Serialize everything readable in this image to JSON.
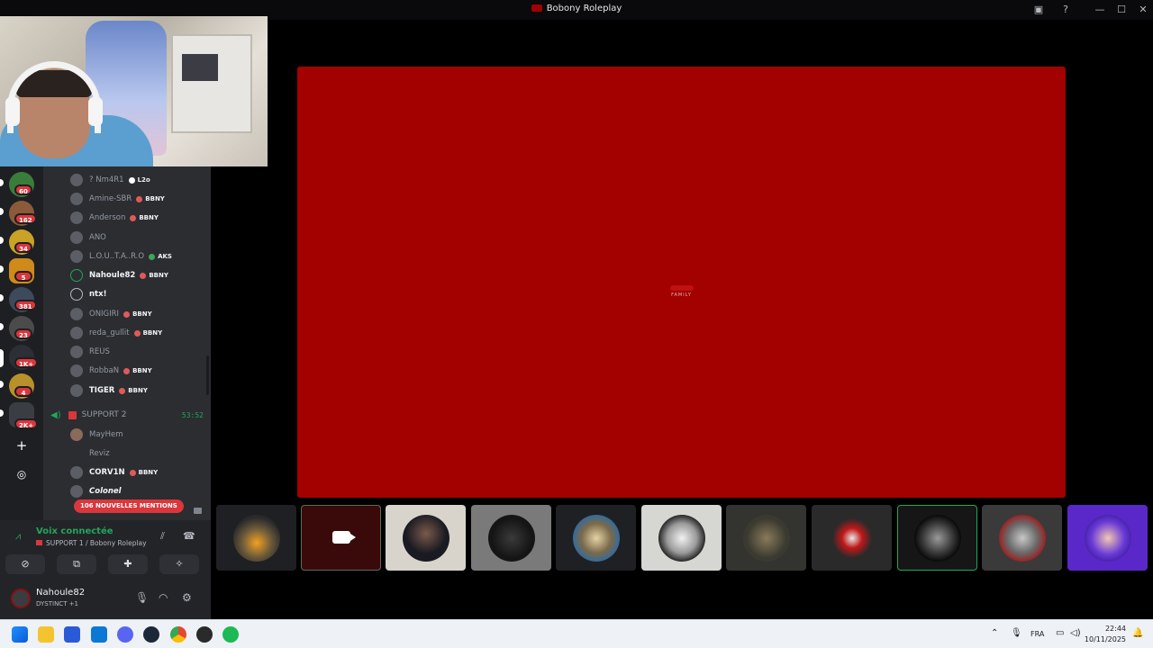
{
  "window": {
    "title": "Bobony Roleplay",
    "controls": [
      "minimize",
      "maximize",
      "close"
    ]
  },
  "servers": [
    {
      "badge": "60"
    },
    {
      "badge": "162"
    },
    {
      "badge": "34"
    },
    {
      "badge": "5"
    },
    {
      "badge": "381"
    },
    {
      "badge": "23"
    },
    {
      "badge": "1K+"
    },
    {
      "badge": "4"
    },
    {
      "badge": "2K+"
    }
  ],
  "members": [
    {
      "name": "? Nm4R1",
      "tag": "L2o",
      "bold": false
    },
    {
      "name": "Amine-SBR",
      "tag": "BBNY",
      "bold": false
    },
    {
      "name": "Anderson",
      "tag": "BBNY",
      "bold": false
    },
    {
      "name": "ANO",
      "tag": "",
      "bold": false
    },
    {
      "name": "L.O.U..T.A..R.O",
      "tag": "AKS",
      "bold": false
    },
    {
      "name": "Nahoule82",
      "tag": "BBNY",
      "bold": true
    },
    {
      "name": "ntx!",
      "tag": "",
      "bold": true
    },
    {
      "name": "ONIGIRI",
      "tag": "BBNY",
      "bold": false
    },
    {
      "name": "reda_gullit",
      "tag": "BBNY",
      "bold": false
    },
    {
      "name": "REUS",
      "tag": "",
      "bold": false
    },
    {
      "name": "RobbaN",
      "tag": "BBNY",
      "bold": false
    },
    {
      "name": "TIGER",
      "tag": "BBNY",
      "bold": true
    }
  ],
  "voice_channel": {
    "name": "SUPPORT 2",
    "timer": "53:52",
    "members": [
      {
        "name": "MayHem",
        "tag": ""
      },
      {
        "name": "Reviz",
        "tag": ""
      },
      {
        "name": "CORV1N",
        "tag": "BBNY"
      },
      {
        "name": "Colonel",
        "tag": ""
      }
    ]
  },
  "mentions_label": "106 NOUVELLES MENTIONS",
  "voice_panel": {
    "status": "Voix connectée",
    "channel": "SUPPORT 1 / Bobony Roleplay"
  },
  "user_panel": {
    "username": "Nahoule82",
    "subtext": "DYSTINCT +1"
  },
  "stage": {
    "brand_text": "FAMILY",
    "color": "#a30000"
  },
  "taskbar": {
    "language": "FRA",
    "time": "22:44",
    "date": "10/11/2025"
  },
  "colors": {
    "accent_green": "#23a55a",
    "badge_red": "#da373c",
    "stage_red": "#a30000",
    "speaking_border": "#23a55a"
  }
}
